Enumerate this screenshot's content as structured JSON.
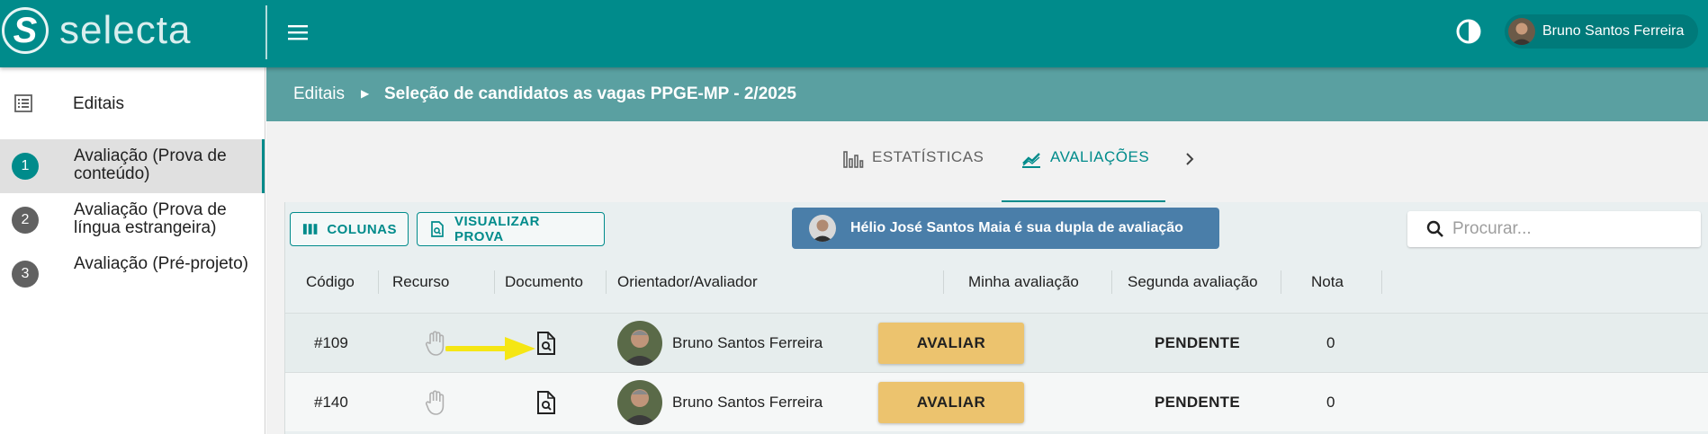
{
  "app": {
    "logo_text": "selecta",
    "logo_letter": "S"
  },
  "header": {
    "user_name": "Bruno Santos Ferreira"
  },
  "sidebar": {
    "editais_label": "Editais",
    "steps": [
      {
        "num": "1",
        "label": "Avaliação (Prova de conteúdo)",
        "active": true
      },
      {
        "num": "2",
        "label": "Avaliação (Prova de língua estrangeira)",
        "active": false
      },
      {
        "num": "3",
        "label": "Avaliação (Pré-projeto)",
        "active": false
      }
    ]
  },
  "breadcrumb": {
    "root": "Editais",
    "separator": "›",
    "current": "Seleção de candidatos as vagas PPGE-MP - 2/2025"
  },
  "tabs": [
    {
      "label": "ESTATÍSTICAS",
      "icon": "bar-chart-icon",
      "active": false
    },
    {
      "label": "AVALIAÇÕES",
      "icon": "trending-up-icon",
      "active": true
    }
  ],
  "toolbar": {
    "columns_label": "COLUNAS",
    "view_exam_label": "VISUALIZAR PROVA",
    "pair_message": "Hélio José Santos Maia é sua dupla de avaliação",
    "search_placeholder": "Procurar..."
  },
  "table": {
    "headers": [
      "Código",
      "Recurso",
      "Documento",
      "Orientador/Avaliador",
      "Minha avaliação",
      "Segunda avaliação",
      "Nota"
    ],
    "rows": [
      {
        "code": "#109",
        "advisor": "Bruno Santos Ferreira",
        "my_eval": "AVALIAR",
        "second_eval": "PENDENTE",
        "grade": "0"
      },
      {
        "code": "#140",
        "advisor": "Bruno Santos Ferreira",
        "my_eval": "AVALIAR",
        "second_eval": "PENDENTE",
        "grade": "0"
      }
    ]
  },
  "colors": {
    "primary": "#008b8b",
    "breadcrumb_bg": "#5aa0a1",
    "banner_bg": "#4a7ea9",
    "evaluate_button": "#ecc36e",
    "annotation_arrow": "#f5e614"
  }
}
